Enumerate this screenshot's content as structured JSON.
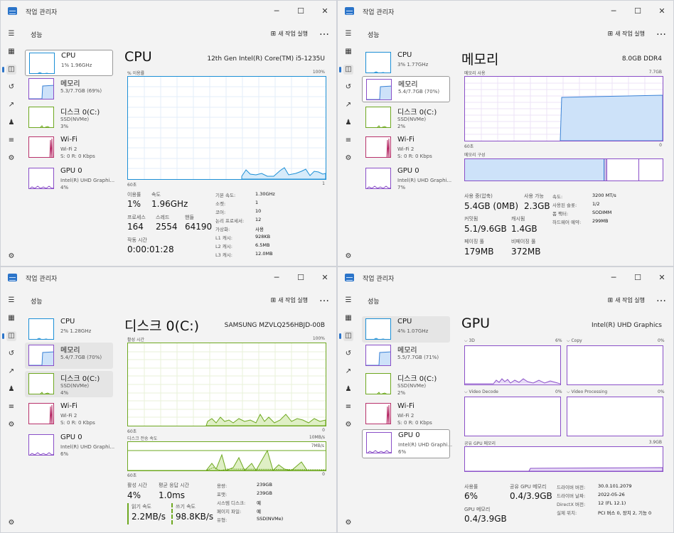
{
  "windows": [
    {
      "title": "작업 관리자",
      "header": "성능",
      "new_task": "새 작업 실행",
      "more": "…",
      "sidebar": [
        {
          "name": "CPU",
          "sub1": "1% 1.96GHz",
          "sub2": "",
          "sub3": ""
        },
        {
          "name": "메모리",
          "sub1": "5.3/7.7GB (69%)",
          "sub2": "",
          "sub3": ""
        },
        {
          "name": "디스크 0(C:)",
          "sub1": "SSD(NVMe)",
          "sub2": "3%",
          "sub3": ""
        },
        {
          "name": "Wi-Fi",
          "sub1": "Wi-Fi 2",
          "sub2": "S: 0 R: 0 Kbps",
          "sub3": ""
        },
        {
          "name": "GPU 0",
          "sub1": "Intel(R) UHD Graphi...",
          "sub2": "4%",
          "sub3": ""
        }
      ],
      "main": {
        "title": "CPU",
        "model": "12th Gen Intel(R) Core(TM) i5-1235U",
        "graph_label": "% 이용률",
        "graph_max": "100%",
        "graph_time": "60초",
        "graph_min": "1",
        "stats": [
          {
            "label": "이용률",
            "value": "1%"
          },
          {
            "label": "속도",
            "value": "1.96GHz"
          },
          {
            "label": "프로세스",
            "value": "164"
          },
          {
            "label": "스레드",
            "value": "2554"
          },
          {
            "label": "핸들",
            "value": "64190"
          },
          {
            "label": "작동 시간",
            "value": "0:00:01:28"
          }
        ],
        "details": [
          {
            "k": "기본 속도:",
            "v": "1.30GHz"
          },
          {
            "k": "소켓:",
            "v": "1"
          },
          {
            "k": "코어:",
            "v": "10"
          },
          {
            "k": "논리 프로세서:",
            "v": "12"
          },
          {
            "k": "가상화:",
            "v": "사용"
          },
          {
            "k": "L1 캐시:",
            "v": "928KB"
          },
          {
            "k": "L2 캐시:",
            "v": "6.5MB"
          },
          {
            "k": "L3 캐시:",
            "v": "12.0MB"
          }
        ]
      }
    },
    {
      "title": "작업 관리자",
      "header": "성능",
      "new_task": "새 작업 실행",
      "more": "…",
      "sidebar": [
        {
          "name": "CPU",
          "sub1": "3% 1.77GHz",
          "sub2": ""
        },
        {
          "name": "메모리",
          "sub1": "5.4/7.7GB (70%)",
          "sub2": ""
        },
        {
          "name": "디스크 0(C:)",
          "sub1": "SSD(NVMe)",
          "sub2": "2%"
        },
        {
          "name": "Wi-Fi",
          "sub1": "Wi-Fi 2",
          "sub2": "S: 0 R: 0 Kbps"
        },
        {
          "name": "GPU 0",
          "sub1": "Intel(R) UHD Graphi...",
          "sub2": "7%"
        }
      ],
      "main": {
        "title": "메모리",
        "model": "8.0GB DDR4",
        "graph_label": "메모리 사용",
        "graph_max": "7.7GB",
        "graph_time": "60초",
        "graph_min": "0",
        "comp_label": "메모리 구성",
        "stats": [
          {
            "label": "사용 중(압축)",
            "value": "5.4GB (0MB)"
          },
          {
            "label": "사용 가능",
            "value": "2.3GB"
          },
          {
            "label": "커밋됨",
            "value": "5.1/9.6GB"
          },
          {
            "label": "캐시됨",
            "value": "1.4GB"
          },
          {
            "label": "페이징 풀",
            "value": "179MB"
          },
          {
            "label": "비페이징 풀",
            "value": "372MB"
          }
        ],
        "details": [
          {
            "k": "속도:",
            "v": "3200 MT/s"
          },
          {
            "k": "사용된 슬롯:",
            "v": "1/2"
          },
          {
            "k": "폼 팩터:",
            "v": "SODIMM"
          },
          {
            "k": "하드웨어 예약:",
            "v": "299MB"
          }
        ]
      }
    },
    {
      "title": "작업 관리자",
      "header": "성능",
      "new_task": "새 작업 실행",
      "more": "…",
      "sidebar": [
        {
          "name": "CPU",
          "sub1": "2% 1.28GHz",
          "sub2": ""
        },
        {
          "name": "메모리",
          "sub1": "5.4/7.7GB (70%)",
          "sub2": ""
        },
        {
          "name": "디스크 0(C:)",
          "sub1": "SSD(NVMe)",
          "sub2": "4%"
        },
        {
          "name": "Wi-Fi",
          "sub1": "Wi-Fi 2",
          "sub2": "S: 0 R: 0 Kbps"
        },
        {
          "name": "GPU 0",
          "sub1": "Intel(R) UHD Graphi...",
          "sub2": "6%"
        }
      ],
      "main": {
        "title": "디스크 0(C:)",
        "model": "SAMSUNG MZVLQ256HBJD-00B",
        "graph_label": "활성 시간",
        "graph_max": "100%",
        "graph_time": "60초",
        "graph_min": "0",
        "graph2_label": "디스크 전송 속도",
        "graph2_max": "10MB/s",
        "graph2_mid": "7MB/s",
        "graph2_time": "60초",
        "graph2_min": "0",
        "stats": [
          {
            "label": "활성 시간",
            "value": "4%"
          },
          {
            "label": "평균 응답 시간",
            "value": "1.0ms"
          },
          {
            "label": "읽기 속도",
            "value": "2.2MB/s"
          },
          {
            "label": "쓰기 속도",
            "value": "98.8KB/s"
          }
        ],
        "details": [
          {
            "k": "용량:",
            "v": "239GB"
          },
          {
            "k": "포맷:",
            "v": "239GB"
          },
          {
            "k": "시스템 디스크:",
            "v": "예"
          },
          {
            "k": "페이지 파일:",
            "v": "예"
          },
          {
            "k": "유형:",
            "v": "SSD(NVMe)"
          }
        ]
      }
    },
    {
      "title": "작업 관리자",
      "header": "성능",
      "new_task": "새 작업 실행",
      "more": "…",
      "sidebar": [
        {
          "name": "CPU",
          "sub1": "4% 1.07GHz",
          "sub2": ""
        },
        {
          "name": "메모리",
          "sub1": "5.5/7.7GB (71%)",
          "sub2": ""
        },
        {
          "name": "디스크 0(C:)",
          "sub1": "SSD(NVMe)",
          "sub2": "2%"
        },
        {
          "name": "Wi-Fi",
          "sub1": "Wi-Fi 2",
          "sub2": "S: 0 R: 0 Kbps"
        },
        {
          "name": "GPU 0",
          "sub1": "Intel(R) UHD Graphi...",
          "sub2": "6%"
        }
      ],
      "main": {
        "title": "GPU",
        "model": "Intel(R) UHD Graphics",
        "engines": [
          {
            "name": "3D",
            "pct": "6%"
          },
          {
            "name": "Copy",
            "pct": "0%"
          },
          {
            "name": "Video Decode",
            "pct": "0%"
          },
          {
            "name": "Video Processing",
            "pct": "0%"
          }
        ],
        "shared_label": "공유 GPU 메모리",
        "shared_max": "3.9GB",
        "stats": [
          {
            "label": "사용률",
            "value": "6%"
          },
          {
            "label": "공유 GPU 메모리",
            "value": "0.4/3.9GB"
          },
          {
            "label": "GPU 메모리",
            "value": "0.4/3.9GB"
          }
        ],
        "details": [
          {
            "k": "드라이버 버전:",
            "v": "30.0.101.2079"
          },
          {
            "k": "드라이버 날짜:",
            "v": "2022-05-26"
          },
          {
            "k": "DirectX 버전:",
            "v": "12 (FL 12.1)"
          },
          {
            "k": "실제 위치:",
            "v": "PCI 버스 0, 장치 2, 기능 0"
          }
        ]
      }
    }
  ],
  "colors": {
    "cpu": "#1c8fd6",
    "mem": "#8a4fc8",
    "disk": "#6ea820",
    "net": "#b8326b",
    "gpu": "#8a4fc8",
    "memfill": "#cde2f9",
    "memline": "#3a82d6",
    "diskfill": "#dfefc5",
    "gpufill": "#e8dcf7",
    "accent": "#2b74c9"
  },
  "icons": [
    "menu-icon",
    "apps-icon",
    "performance-icon",
    "history-icon",
    "startup-icon",
    "users-icon",
    "details-icon",
    "services-icon",
    "settings-icon",
    "new-task-icon",
    "minimize-icon",
    "maximize-icon",
    "close-icon"
  ]
}
